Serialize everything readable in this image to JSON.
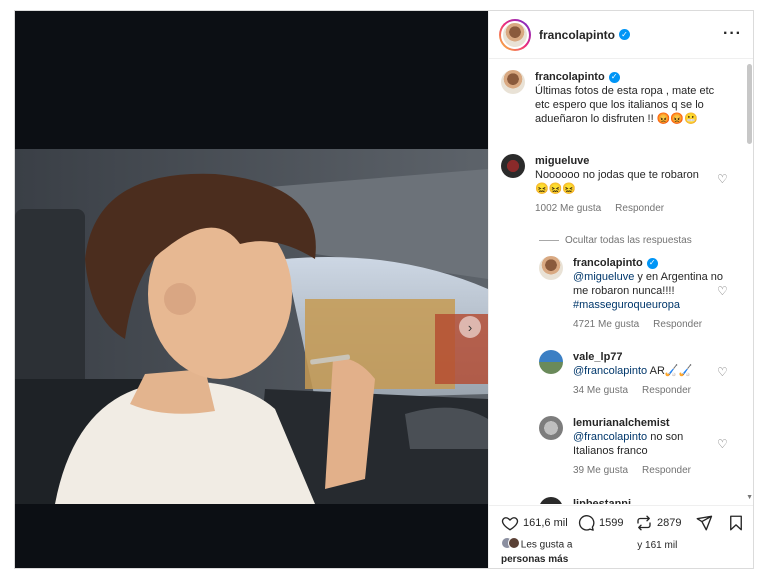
{
  "post": {
    "username": "francolapinto",
    "caption": "Últimas fotos de esta ropa , mate etc etc espero que los italianos q se lo adueñaron lo disfruten !! 😡😡😬"
  },
  "comments": [
    {
      "username": "migueluve",
      "text": "Noooooo no jodas que te robaron 😖😖😖",
      "likes": "1002 Me gusta",
      "reply": "Responder",
      "hide_replies": "Ocultar todas las respuestas"
    },
    {
      "username": "francolapinto",
      "mention": "@migueluve",
      "text": " y en Argentina no me robaron nunca!!!! ",
      "hashtag": "#masseguroqueuropa",
      "likes": "4721 Me gusta",
      "reply": "Responder"
    },
    {
      "username": "vale_lp77",
      "mention": "@francolapinto",
      "text": " AR🏑🏑",
      "likes": "34 Me gusta",
      "reply": "Responder"
    },
    {
      "username": "lemurianalchemist",
      "mention": "@francolapinto",
      "text": " no son Italianos franco",
      "likes": "39 Me gusta",
      "reply": "Responder"
    },
    {
      "username": "lipbestanni"
    }
  ],
  "actions": {
    "like_count": "161,6 mil",
    "comment_count": "1599",
    "repost_count": "2879"
  },
  "likes_summary": {
    "prefix": "Les gusta a",
    "suffix": "y 161 mil",
    "tail": "personas más"
  },
  "icons": {
    "verified": "verified-badge-icon",
    "more": "more-options-icon",
    "next": "chevron-right-icon",
    "heart": "heart-icon",
    "comment": "comment-icon",
    "repost": "repost-icon",
    "share": "send-icon",
    "save": "bookmark-icon"
  },
  "colors": {
    "accent": "#0095f6",
    "link": "#00376b",
    "muted": "#737373"
  }
}
